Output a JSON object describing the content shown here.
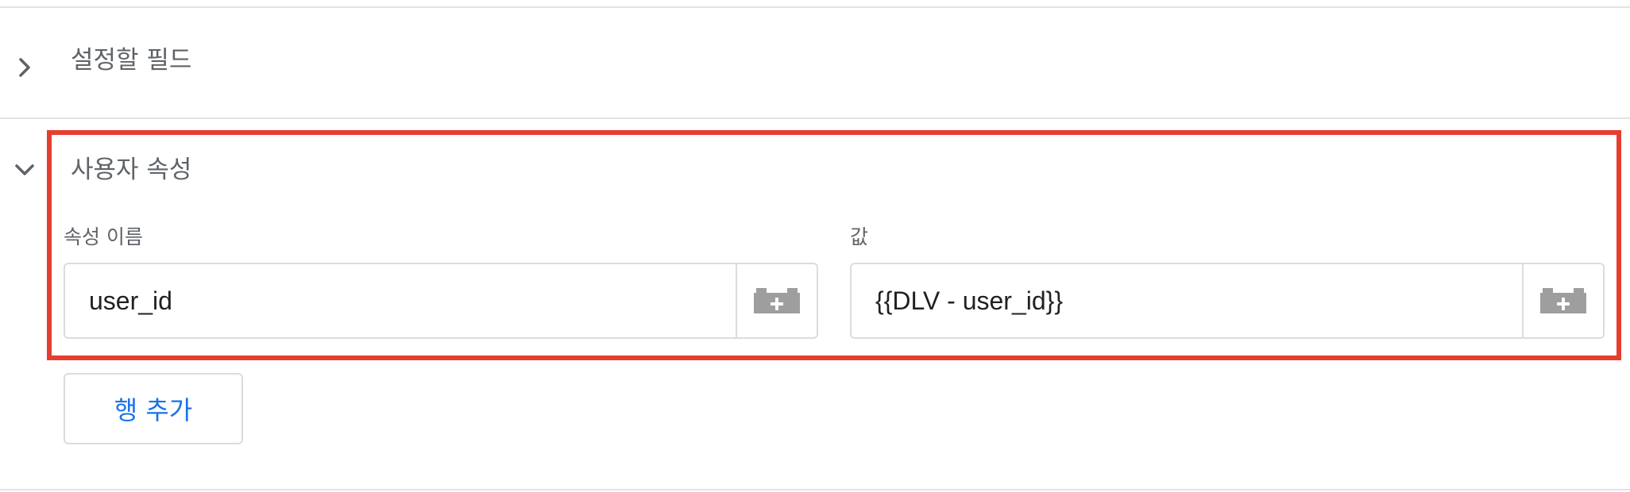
{
  "sections": [
    {
      "title": "설정할 필드",
      "expanded": false,
      "chevron_icon": "chevron-right-icon"
    },
    {
      "title": "사용자 속성",
      "expanded": true,
      "chevron_icon": "chevron-down-icon"
    }
  ],
  "user_properties": {
    "name_label": "속성 이름",
    "value_label": "값",
    "row": {
      "name_value": "user_id",
      "value_value": "{{DLV - user_id}}"
    },
    "variable_picker_icon": "variable-brick-icon",
    "add_row_label": "행 추가"
  },
  "colors": {
    "highlight_border": "#e53e2e",
    "accent_link": "#1a73e8",
    "text_muted": "#5f6368",
    "icon_gray": "#9e9e9e",
    "divider": "#e3e3e3"
  }
}
